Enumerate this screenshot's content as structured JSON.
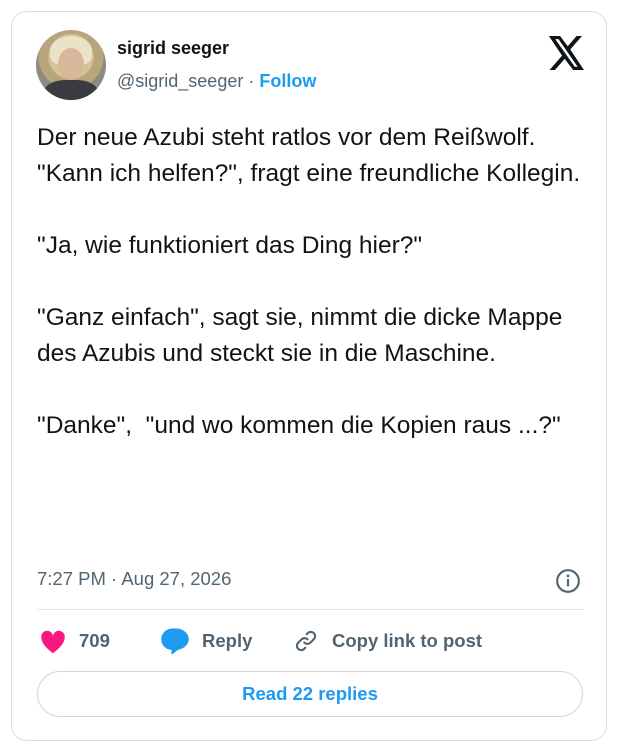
{
  "author": {
    "name": "sigrid seeger",
    "handle": "@sigrid_seeger",
    "separator": "·",
    "follow_label": "Follow"
  },
  "post": {
    "text": "Der neue Azubi steht ratlos vor dem Reißwolf. \"Kann ich helfen?\", fragt eine freundliche Kollegin.\n\n\"Ja, wie funktioniert das Ding hier?\"\n\n\"Ganz einfach\", sagt sie, nimmt die dicke Mappe des Azubis und steckt sie in die Maschine.\n\n\"Danke\",  \"und wo kommen die Kopien raus ...?\"",
    "timestamp": "7:27 PM · Aug 27, 2026"
  },
  "actions": {
    "like_count": "709",
    "reply_label": "Reply",
    "copy_link_label": "Copy link to post"
  },
  "read_replies_label": "Read 22 replies",
  "colors": {
    "accent": "#1d9bf0",
    "like": "#f91880",
    "secondary_text": "#536471"
  },
  "icons": [
    "x-logo-icon",
    "info-icon",
    "heart-icon",
    "reply-bubble-icon",
    "link-icon"
  ]
}
